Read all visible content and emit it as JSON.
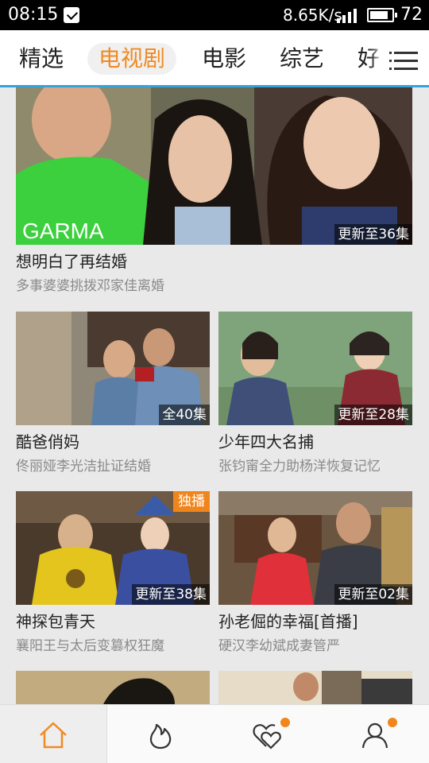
{
  "status_bar": {
    "time": "08:15",
    "speed": "8.65K/s",
    "battery_level": "72",
    "notification_icon": "app-notification-icon",
    "signal_icon": "signal-icon",
    "battery_icon": "battery-icon"
  },
  "tabs": {
    "items": [
      "精选",
      "电视剧",
      "电影",
      "综艺",
      "好"
    ],
    "selected": "电视剧",
    "menu_icon": "menu-icon"
  },
  "colors": {
    "accent": "#f08a24",
    "tab_underline": "#33a3dc",
    "tag_bg": "#f0851c"
  },
  "featured": {
    "title": "想明白了再结婚",
    "subtitle": "多事婆婆挑拨邓家佳离婚",
    "badge": "更新至36集"
  },
  "shows": [
    {
      "title": "酷爸俏妈",
      "subtitle": "佟丽娅李光洁扯证结婚",
      "badge": "全40集",
      "tag": ""
    },
    {
      "title": "少年四大名捕",
      "subtitle": "张钧甯全力助杨洋恢复记忆",
      "badge": "更新至28集",
      "tag": ""
    },
    {
      "title": "神探包青天",
      "subtitle": "襄阳王与太后变篡权狂魔",
      "badge": "更新至38集",
      "tag": "独播"
    },
    {
      "title": "孙老倔的幸福[首播]",
      "subtitle": "硬汉李幼斌成妻管严",
      "badge": "更新至02集",
      "tag": ""
    }
  ],
  "bottom_nav": {
    "items": [
      "home-icon",
      "hot-flame-icon",
      "favorites-heart-icon",
      "user-profile-icon"
    ],
    "selected": "home-icon"
  }
}
